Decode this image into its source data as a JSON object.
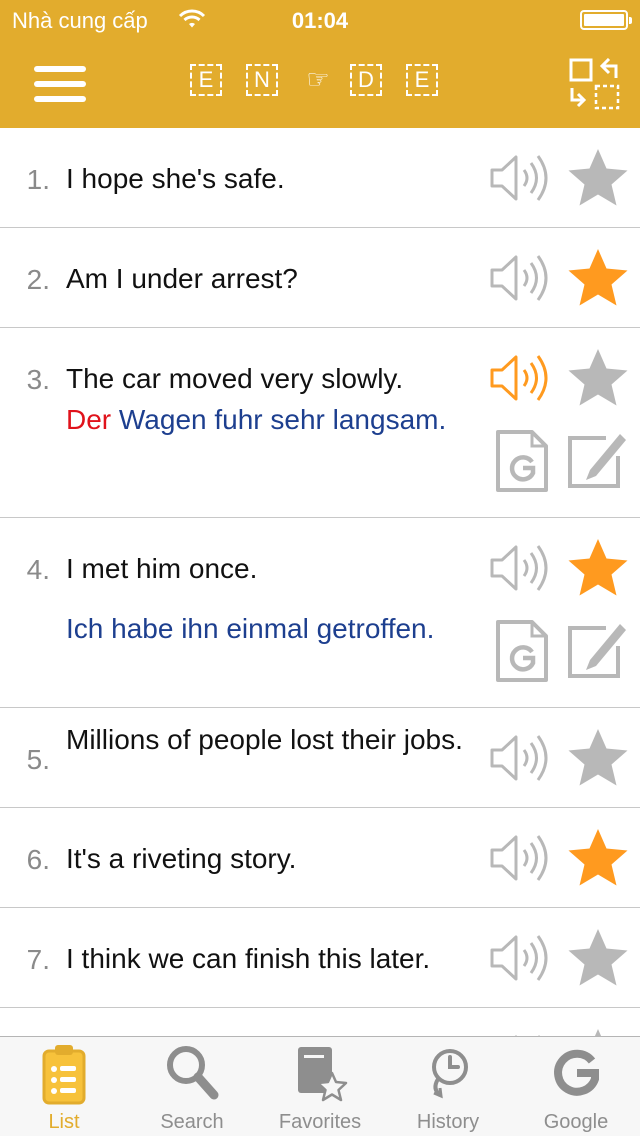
{
  "status_bar": {
    "carrier": "Nhà cung cấp",
    "time": "01:04"
  },
  "header": {
    "languages": [
      "E",
      "N",
      "D",
      "E"
    ],
    "direction_icon": "pointing-hand-icon",
    "menu_icon": "hamburger-icon",
    "swap_icon": "swap-languages-icon"
  },
  "colors": {
    "header": "#e2ac2d",
    "accent": "#ff9a1f",
    "inactive_icon": "#b8b8b8",
    "translation_text": "#1d3f8f",
    "article_text": "#e0121b"
  },
  "sentences": [
    {
      "number": "1.",
      "text": "I hope she's safe.",
      "favorite": false,
      "playing": false
    },
    {
      "number": "2.",
      "text": "Am I under arrest?",
      "favorite": true,
      "playing": false
    },
    {
      "number": "3.",
      "text": "The car moved very slowly.",
      "favorite": false,
      "playing": true,
      "translation_article": "Der",
      "translation_rest": " Wagen fuhr sehr langsam."
    },
    {
      "number": "4.",
      "text": "I met him once.",
      "favorite": true,
      "playing": false,
      "translation_article": "",
      "translation_rest": "Ich habe ihn einmal getroffen."
    },
    {
      "number": "5.",
      "text": "Millions of people lost their jobs.",
      "favorite": false,
      "playing": false
    },
    {
      "number": "6.",
      "text": "It's a riveting story.",
      "favorite": true,
      "playing": false
    },
    {
      "number": "7.",
      "text": "I think we can finish this later.",
      "favorite": false,
      "playing": false
    }
  ],
  "tabs": [
    {
      "label": "List",
      "icon": "list-clipboard-icon",
      "active": true
    },
    {
      "label": "Search",
      "icon": "magnifier-icon",
      "active": false
    },
    {
      "label": "Favorites",
      "icon": "favorites-book-icon",
      "active": false
    },
    {
      "label": "History",
      "icon": "history-clock-icon",
      "active": false
    },
    {
      "label": "Google",
      "icon": "google-g-icon",
      "active": false
    }
  ]
}
